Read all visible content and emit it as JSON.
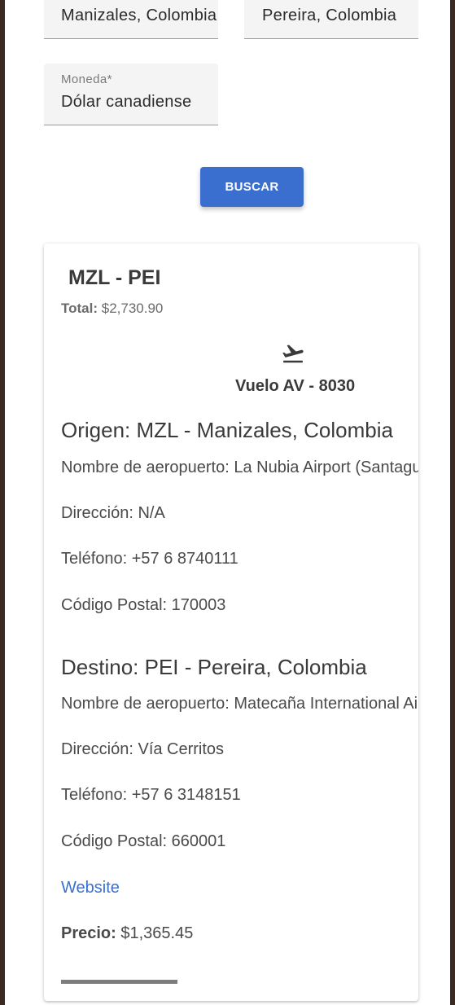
{
  "search": {
    "origin_value": "Manizales, Colombia",
    "destination_value": "Pereira, Colombia",
    "currency_label": "Moneda*",
    "currency_value": "Dólar canadiense",
    "search_button": "BUSCAR"
  },
  "result": {
    "route": "MZL - PEI",
    "total_label": "Total:",
    "total_value": "$2,730.90",
    "flight_icon": "flight-takeoff-icon",
    "flight_label": "Vuelo AV - 8030",
    "origin": {
      "heading": "Origen: MZL - Manizales, Colombia",
      "airport": "Nombre de aeropuerto: La Nubia Airport (Santaguida)",
      "address": "Dirección: N/A",
      "phone": "Teléfono: +57 6 8740111",
      "postal": "Código Postal: 170003"
    },
    "destination": {
      "heading": "Destino: PEI - Pereira, Colombia",
      "airport": "Nombre de aeropuerto: Matecaña International Airport",
      "address": "Dirección: Vía Cerritos",
      "phone": "Teléfono: +57 6 3148151",
      "postal": "Código Postal: 660001"
    },
    "website_link": "Website",
    "price_label": "Precio:",
    "price_value": "$1,365.45"
  },
  "colors": {
    "accent": "#3a6fd0",
    "frame": "#3b2a24"
  }
}
